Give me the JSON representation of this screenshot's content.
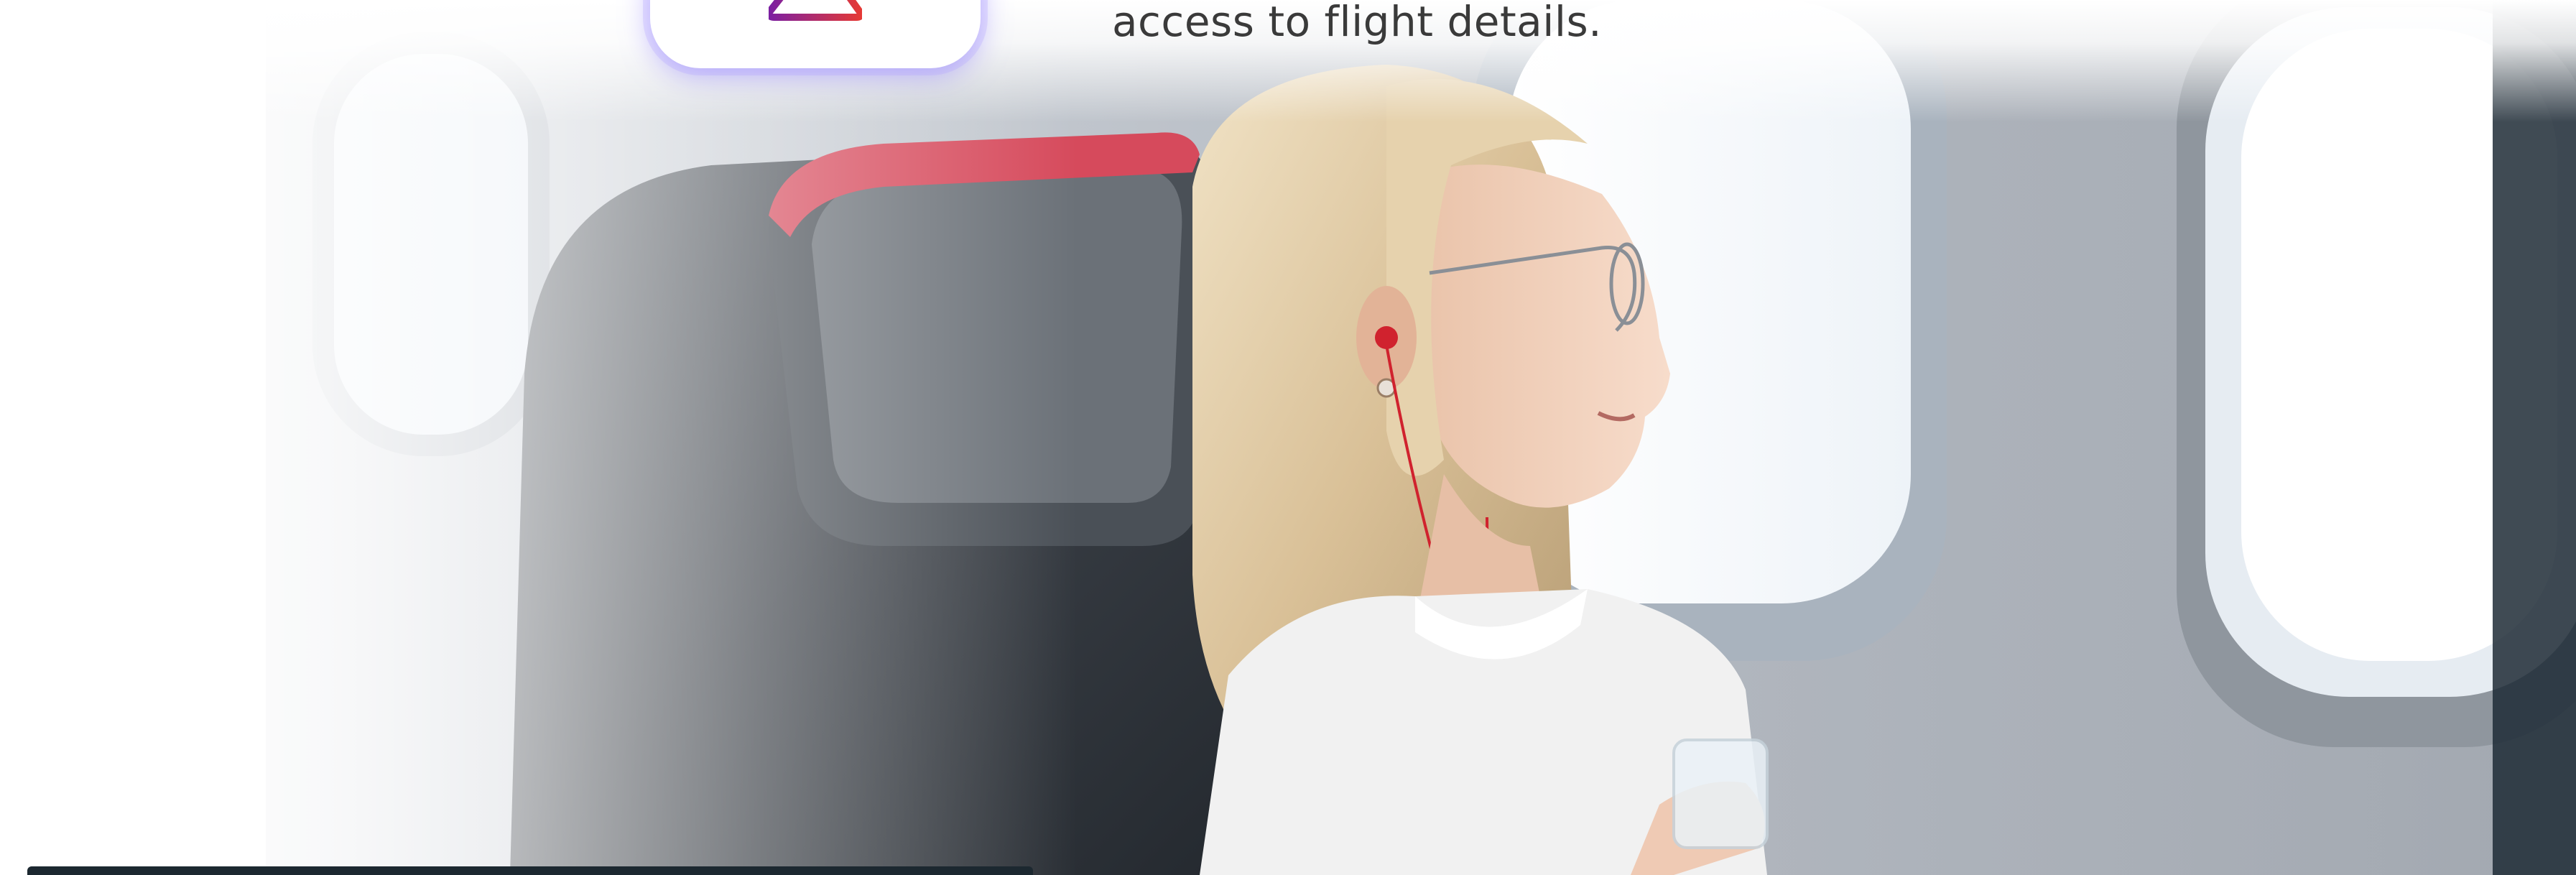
{
  "caption": {
    "text": "access to flight details."
  },
  "app_icon": {
    "name": "airline-app-icon",
    "accent_color": "#c2185b"
  },
  "hero": {
    "photo_subject": "woman-looking-out-airplane-window"
  }
}
